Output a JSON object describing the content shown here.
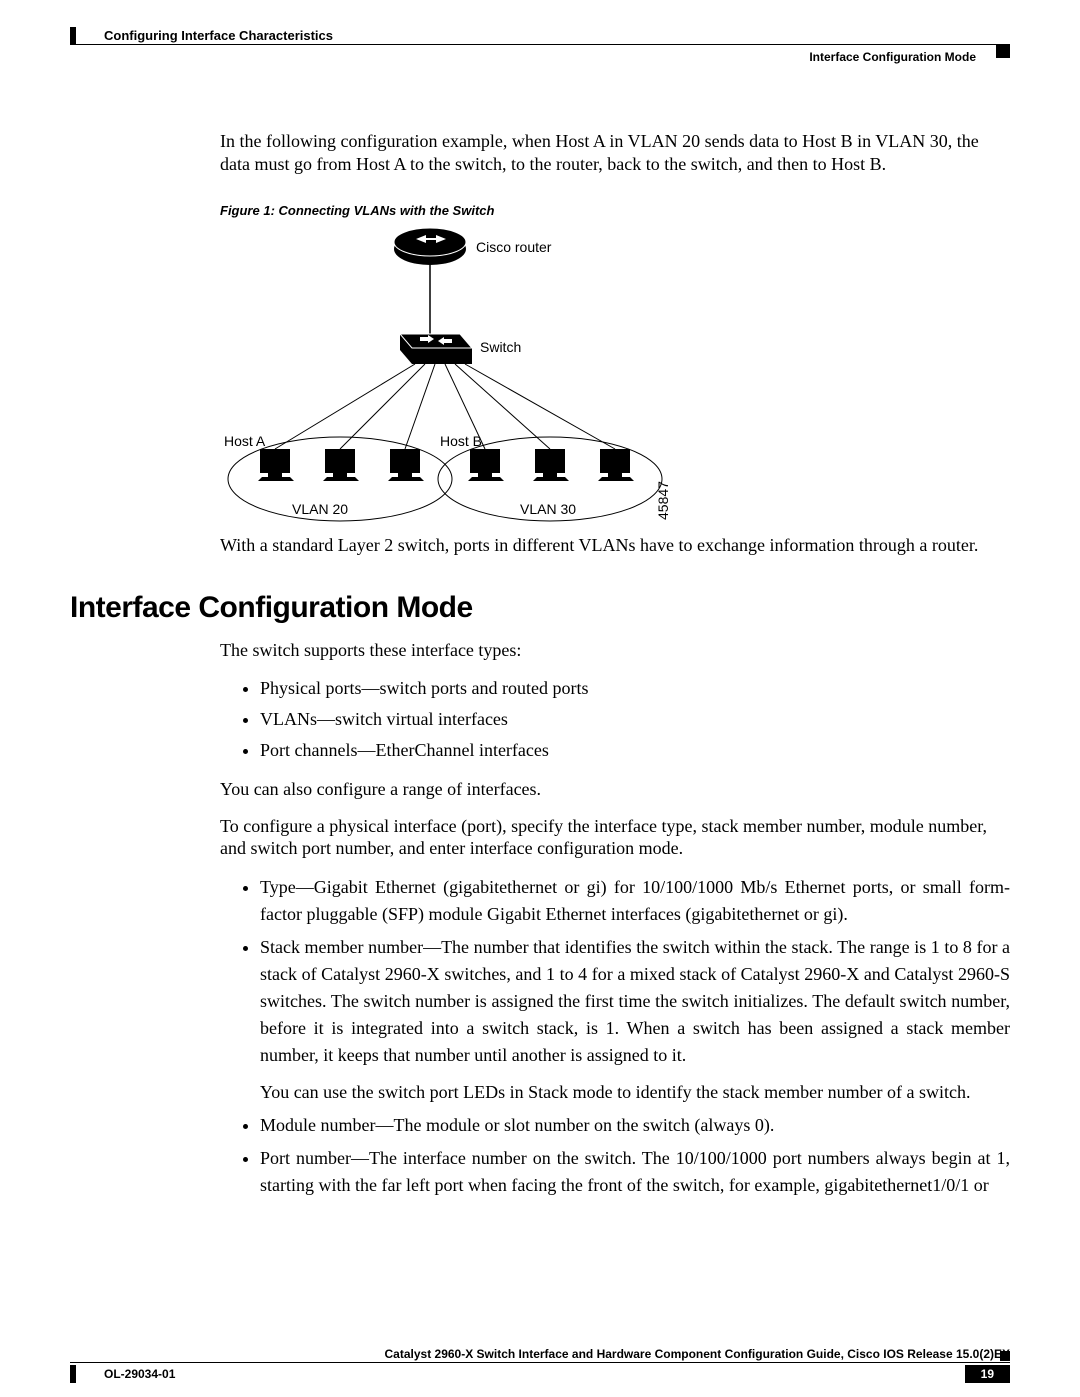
{
  "header": {
    "chapter": "Configuring Interface Characteristics",
    "section": "Interface Configuration Mode"
  },
  "intro": "In the following configuration example, when Host A in VLAN 20 sends data to Host B in VLAN 30, the data must go from Host A to the switch, to the router, back to the switch, and then to Host B.",
  "figure_caption": "Figure 1: Connecting VLANs with the Switch",
  "diagram": {
    "router": "Cisco router",
    "switch": "Switch",
    "host_a": "Host A",
    "host_b": "Host B",
    "vlan20": "VLAN 20",
    "vlan30": "VLAN 30",
    "figid": "45847"
  },
  "post_figure": "With a standard Layer 2 switch, ports in different VLANs have to exchange information through a router.",
  "h1": "Interface Configuration Mode",
  "p1": "The switch supports these interface types:",
  "list1": {
    "i0": "Physical ports—switch ports and routed ports",
    "i1": "VLANs—switch virtual interfaces",
    "i2": "Port channels—EtherChannel interfaces"
  },
  "p2": "You can also configure a range of interfaces.",
  "p3": "To configure a physical interface (port), specify the interface type, stack member number, module number, and switch port number, and enter interface configuration mode.",
  "list2": {
    "i0": "Type—Gigabit Ethernet (gigabitethernet or gi) for 10/100/1000 Mb/s Ethernet ports, or small form-factor pluggable (SFP) module Gigabit Ethernet interfaces (gigabitethernet or gi).",
    "i1": "Stack member number—The number that identifies the switch within the stack. The range is 1 to 8 for a stack of Catalyst 2960-X switches, and 1 to 4 for a mixed stack of Catalyst 2960-X and Catalyst 2960-S switches. The switch number is assigned the first time the switch initializes. The default switch number, before it is integrated into a switch stack, is 1. When a switch has been assigned a stack member number, it keeps that number until another is assigned to it.",
    "i1_note": "You can use the switch port LEDs in Stack mode to identify the stack member number of a switch.",
    "i2": "Module number—The module or slot number on the switch (always 0).",
    "i3": "Port number—The interface number on the switch. The 10/100/1000 port numbers always begin at 1, starting with the far left port when facing the front of the switch, for example, gigabitethernet1/0/1 or"
  },
  "footer": {
    "book": "Catalyst 2960-X Switch Interface and Hardware Component Configuration Guide, Cisco IOS Release 15.0(2)EX",
    "docid": "OL-29034-01",
    "page": "19"
  }
}
